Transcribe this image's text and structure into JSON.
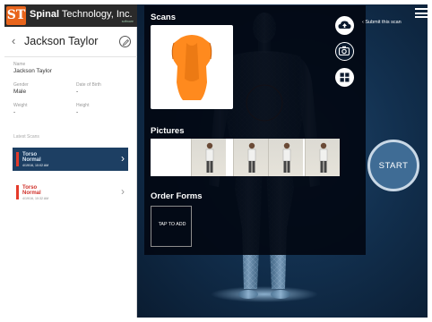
{
  "brand": {
    "initials": "ST",
    "name_bold": "Spinal",
    "name_rest": " Technology, Inc.",
    "sub": "software"
  },
  "patient": {
    "name": "Jackson Taylor",
    "fields": {
      "name_label": "Name",
      "name_value": "Jackson Taylor",
      "gender_label": "Gender",
      "gender_value": "Male",
      "dob_label": "Date of Birth",
      "dob_value": "-",
      "weight_label": "Weight",
      "weight_value": "-",
      "height_label": "Height",
      "height_value": "-"
    }
  },
  "latest_scans": {
    "label": "Latest Scans",
    "items": [
      {
        "line1": "Torso",
        "line2": "Normal",
        "date": "4/19/16, 10:02 AM",
        "selected": true
      },
      {
        "line1": "Torso",
        "line2": "Normal",
        "date": "4/19/16, 10:32 AM",
        "selected": false
      }
    ]
  },
  "main": {
    "scans_title": "Scans",
    "pictures_title": "Pictures",
    "order_forms_title": "Order Forms",
    "tap_to_add": "TAP TO ADD",
    "submit_label": "Submit this scan",
    "start_label": "START"
  },
  "colors": {
    "brand_orange": "#e8641b",
    "selected_row": "#1d3f63",
    "scan_model": "#ff8a1e",
    "start_button": "#3f6c95",
    "accent_red": "#e53a2a"
  },
  "icons": [
    "back-chevron-icon",
    "edit-icon",
    "upload-cloud-icon",
    "camera-icon",
    "grid-icon",
    "hamburger-menu-icon"
  ]
}
